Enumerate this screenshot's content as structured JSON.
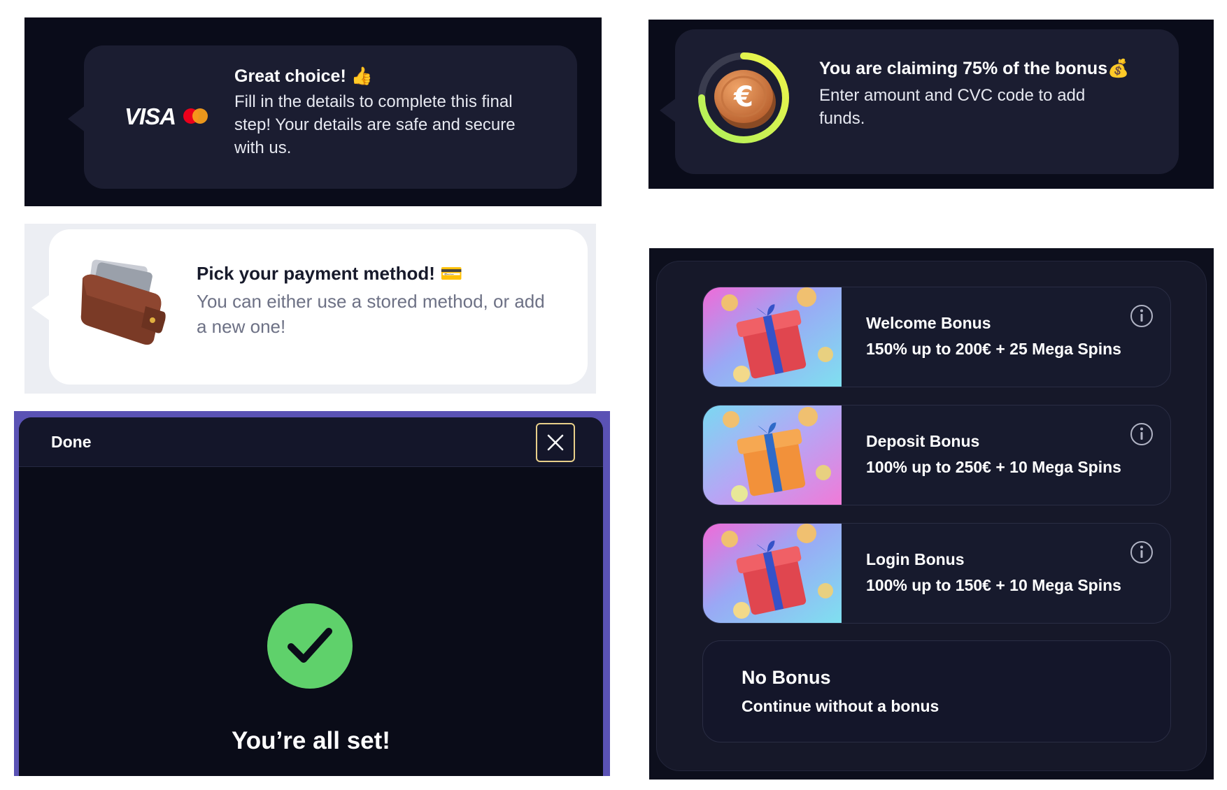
{
  "visa_panel": {
    "logo_text": "VISA",
    "title": "Great choice! 👍",
    "body": "Fill in the details to complete this final step! Your details are safe and secure with us."
  },
  "claim_panel": {
    "title": "You are claiming 75% of the bonus💰",
    "body": "Enter amount and CVC code to add funds.",
    "progress_fraction": 0.75,
    "colors": {
      "ring": "#d8f24a",
      "track": "#3a3c4e",
      "coin": "#d9854a"
    }
  },
  "payment_panel": {
    "title": "Pick your payment method! 💳",
    "body": "You can either use a stored method, or add a new one!"
  },
  "done_panel": {
    "header_title": "Done",
    "close_icon": "close-icon",
    "status_icon": "check-circle-icon",
    "message": "You’re all set!",
    "colors": {
      "success": "#5fd16b",
      "close_border": "#e8cf8a"
    }
  },
  "bonus_panel": {
    "bonuses": [
      {
        "name": "Welcome Bonus",
        "offer": "150% up to 200€ + 25 Mega Spins",
        "gift_color": "#e0464f"
      },
      {
        "name": "Deposit Bonus",
        "offer": "100% up to 250€ + 10 Mega Spins",
        "gift_color": "#f2913a"
      },
      {
        "name": "Login Bonus",
        "offer": "100% up to 150€ + 10 Mega Spins",
        "gift_color": "#e0464f"
      }
    ],
    "no_bonus": {
      "title": "No Bonus",
      "subtitle": "Continue without a bonus"
    }
  }
}
